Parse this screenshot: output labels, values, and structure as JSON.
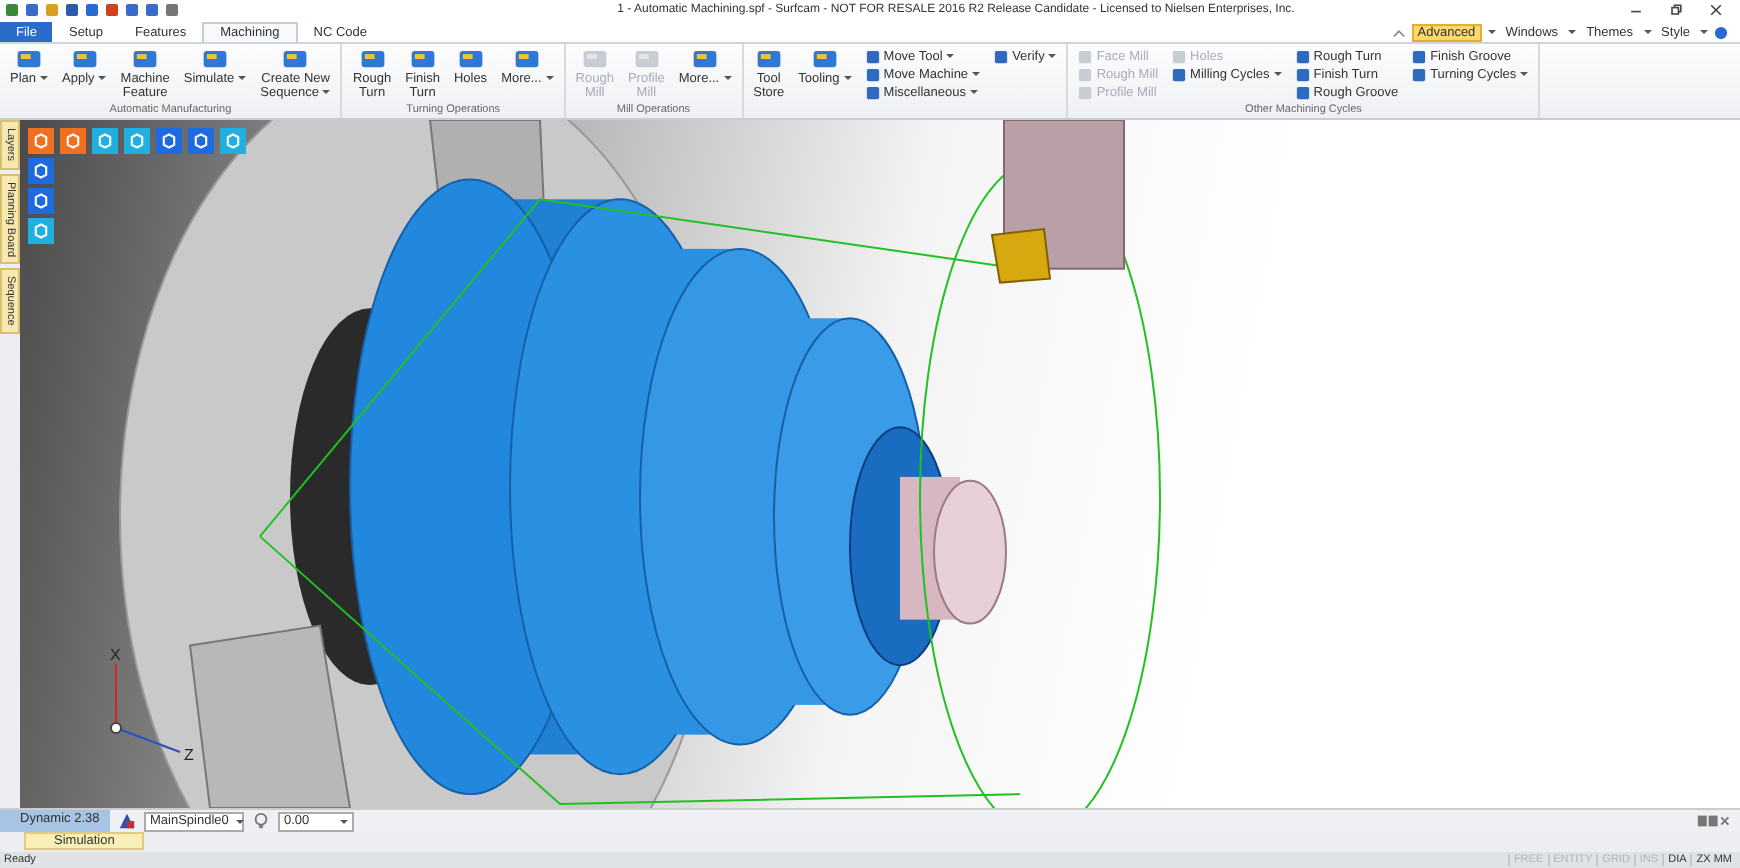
{
  "window": {
    "title": "1 - Automatic Machining.spf - Surfcam - NOT FOR RESALE 2016 R2 Release Candidate - Licensed to Nielsen Enterprises, Inc."
  },
  "tabs": [
    {
      "label": "File",
      "kind": "file",
      "selected": false
    },
    {
      "label": "Setup",
      "kind": "tab",
      "selected": false
    },
    {
      "label": "Features",
      "kind": "tab",
      "selected": false
    },
    {
      "label": "Machining",
      "kind": "tab",
      "selected": true
    },
    {
      "label": "NC Code",
      "kind": "tab",
      "selected": false
    }
  ],
  "right_menu": [
    {
      "label": "Advanced",
      "selected": true
    },
    {
      "label": "Windows",
      "selected": false
    },
    {
      "label": "Themes",
      "selected": false
    },
    {
      "label": "Style",
      "selected": false
    }
  ],
  "ribbon_groups": [
    {
      "label": "Automatic Manufacturing",
      "items": [
        {
          "kind": "large",
          "lines": [
            "Plan"
          ],
          "dropdown": true,
          "disabled": false
        },
        {
          "kind": "large",
          "lines": [
            "Apply"
          ],
          "dropdown": true,
          "disabled": false
        },
        {
          "kind": "large",
          "lines": [
            "Machine",
            "Feature"
          ],
          "dropdown": false,
          "disabled": false
        },
        {
          "kind": "large",
          "lines": [
            "Simulate"
          ],
          "dropdown": true,
          "disabled": false
        },
        {
          "kind": "large",
          "lines": [
            "Create New",
            "Sequence"
          ],
          "dropdown": true,
          "disabled": false
        }
      ]
    },
    {
      "label": "Turning Operations",
      "items": [
        {
          "kind": "large",
          "lines": [
            "Rough",
            "Turn"
          ],
          "dropdown": false,
          "disabled": false
        },
        {
          "kind": "large",
          "lines": [
            "Finish",
            "Turn"
          ],
          "dropdown": false,
          "disabled": false
        },
        {
          "kind": "large",
          "lines": [
            "Holes"
          ],
          "dropdown": false,
          "disabled": false
        },
        {
          "kind": "large",
          "lines": [
            "More..."
          ],
          "dropdown": true,
          "disabled": false
        }
      ]
    },
    {
      "label": "Mill Operations",
      "items": [
        {
          "kind": "large",
          "lines": [
            "Rough",
            "Mill"
          ],
          "dropdown": false,
          "disabled": true
        },
        {
          "kind": "large",
          "lines": [
            "Profile",
            "Mill"
          ],
          "dropdown": false,
          "disabled": true
        },
        {
          "kind": "large",
          "lines": [
            "More..."
          ],
          "dropdown": true,
          "disabled": false
        }
      ]
    },
    {
      "items": [
        {
          "kind": "large",
          "lines": [
            "Tool",
            "Store"
          ],
          "dropdown": false,
          "disabled": false
        },
        {
          "kind": "large",
          "lines": [
            "Tooling"
          ],
          "dropdown": true,
          "disabled": false
        },
        {
          "kind": "stack",
          "buttons": [
            {
              "label": "Move Tool",
              "dropdown": true,
              "disabled": false
            },
            {
              "label": "Move Machine",
              "dropdown": true,
              "disabled": false
            },
            {
              "label": "Miscellaneous",
              "dropdown": true,
              "disabled": false
            }
          ]
        },
        {
          "kind": "stack",
          "buttons": [
            {
              "label": "Verify",
              "dropdown": true,
              "disabled": false
            }
          ]
        }
      ]
    },
    {
      "label": "Other Machining Cycles",
      "items": [
        {
          "kind": "stack",
          "buttons": [
            {
              "label": "Face Mill",
              "dropdown": false,
              "disabled": true
            },
            {
              "label": "Rough Mill",
              "dropdown": false,
              "disabled": true
            },
            {
              "label": "Profile Mill",
              "dropdown": false,
              "disabled": true
            }
          ]
        },
        {
          "kind": "stack",
          "buttons": [
            {
              "label": "Holes",
              "dropdown": false,
              "disabled": true
            },
            {
              "label": "Milling Cycles",
              "dropdown": true,
              "disabled": false
            }
          ]
        },
        {
          "kind": "stack",
          "buttons": [
            {
              "label": "Rough Turn",
              "dropdown": false,
              "disabled": false
            },
            {
              "label": "Finish Turn",
              "dropdown": false,
              "disabled": false
            },
            {
              "label": "Rough Groove",
              "dropdown": false,
              "disabled": false
            }
          ]
        },
        {
          "kind": "stack",
          "buttons": [
            {
              "label": "Finish Groove",
              "dropdown": false,
              "disabled": false
            },
            {
              "label": "Turning Cycles",
              "dropdown": true,
              "disabled": false
            }
          ]
        }
      ]
    }
  ],
  "side_tabs": [
    "Layers",
    "Planning Board",
    "Sequence"
  ],
  "viewport": {
    "axis_labels": [
      "X",
      "Z"
    ]
  },
  "view_bar": {
    "mode": "Dynamic 2.38",
    "spindle": "MainSpindle0",
    "value": "0.00"
  },
  "bottom_tabs": [
    {
      "label": "Simulation",
      "selected": true
    }
  ],
  "status_bar": {
    "text": "Ready",
    "indicators": [
      {
        "label": "FREE",
        "active": false
      },
      {
        "label": "ENTITY",
        "active": false
      },
      {
        "label": "GRID",
        "active": false
      },
      {
        "label": "INS",
        "active": false
      },
      {
        "label": "DIA",
        "active": true
      },
      {
        "label": "ZX MM",
        "active": true
      }
    ]
  }
}
